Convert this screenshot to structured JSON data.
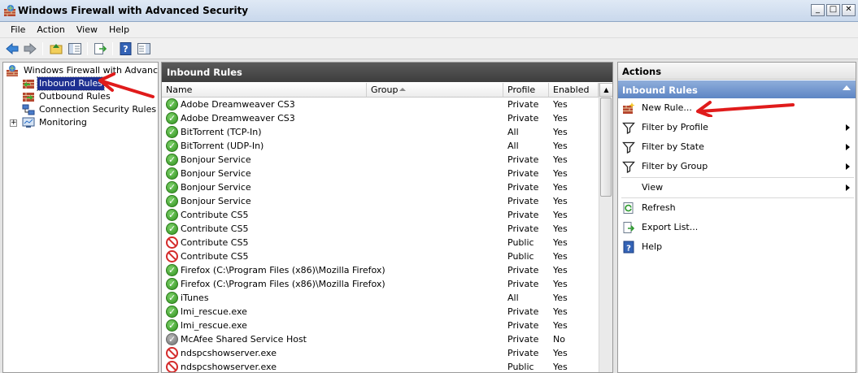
{
  "window": {
    "title": "Windows Firewall with Advanced Security"
  },
  "menu": [
    "File",
    "Action",
    "View",
    "Help"
  ],
  "tree": {
    "root": "Windows Firewall with Advanced S",
    "items": [
      "Inbound Rules",
      "Outbound Rules",
      "Connection Security Rules",
      "Monitoring"
    ],
    "expander": "+"
  },
  "center": {
    "title": "Inbound Rules",
    "columns": [
      "Name",
      "Group",
      "Profile",
      "Enabled"
    ],
    "rows": [
      {
        "status": "allow",
        "name": "Adobe Dreamweaver CS3",
        "group": "",
        "profile": "Private",
        "enabled": "Yes"
      },
      {
        "status": "allow",
        "name": "Adobe Dreamweaver CS3",
        "group": "",
        "profile": "Private",
        "enabled": "Yes"
      },
      {
        "status": "allow",
        "name": "BitTorrent (TCP-In)",
        "group": "",
        "profile": "All",
        "enabled": "Yes"
      },
      {
        "status": "allow",
        "name": "BitTorrent (UDP-In)",
        "group": "",
        "profile": "All",
        "enabled": "Yes"
      },
      {
        "status": "allow",
        "name": "Bonjour Service",
        "group": "",
        "profile": "Private",
        "enabled": "Yes"
      },
      {
        "status": "allow",
        "name": "Bonjour Service",
        "group": "",
        "profile": "Private",
        "enabled": "Yes"
      },
      {
        "status": "allow",
        "name": "Bonjour Service",
        "group": "",
        "profile": "Private",
        "enabled": "Yes"
      },
      {
        "status": "allow",
        "name": "Bonjour Service",
        "group": "",
        "profile": "Private",
        "enabled": "Yes"
      },
      {
        "status": "allow",
        "name": "Contribute CS5",
        "group": "",
        "profile": "Private",
        "enabled": "Yes"
      },
      {
        "status": "allow",
        "name": "Contribute CS5",
        "group": "",
        "profile": "Private",
        "enabled": "Yes"
      },
      {
        "status": "block",
        "name": "Contribute CS5",
        "group": "",
        "profile": "Public",
        "enabled": "Yes"
      },
      {
        "status": "block",
        "name": "Contribute CS5",
        "group": "",
        "profile": "Public",
        "enabled": "Yes"
      },
      {
        "status": "allow",
        "name": "Firefox (C:\\Program Files (x86)\\Mozilla Firefox)",
        "group": "",
        "profile": "Private",
        "enabled": "Yes"
      },
      {
        "status": "allow",
        "name": "Firefox (C:\\Program Files (x86)\\Mozilla Firefox)",
        "group": "",
        "profile": "Private",
        "enabled": "Yes"
      },
      {
        "status": "allow",
        "name": "iTunes",
        "group": "",
        "profile": "All",
        "enabled": "Yes"
      },
      {
        "status": "allow",
        "name": "lmi_rescue.exe",
        "group": "",
        "profile": "Private",
        "enabled": "Yes"
      },
      {
        "status": "allow",
        "name": "lmi_rescue.exe",
        "group": "",
        "profile": "Private",
        "enabled": "Yes"
      },
      {
        "status": "disabled",
        "name": "McAfee Shared Service Host",
        "group": "",
        "profile": "Private",
        "enabled": "No"
      },
      {
        "status": "block",
        "name": "ndspcshowserver.exe",
        "group": "",
        "profile": "Private",
        "enabled": "Yes"
      },
      {
        "status": "block",
        "name": "ndspcshowserver.exe",
        "group": "",
        "profile": "Public",
        "enabled": "Yes"
      }
    ]
  },
  "actions": {
    "title": "Actions",
    "section": "Inbound Rules",
    "items": [
      {
        "label": "New Rule...",
        "icon": "new-rule-icon",
        "submenu": false
      },
      {
        "label": "Filter by Profile",
        "icon": "filter-icon",
        "submenu": true
      },
      {
        "label": "Filter by State",
        "icon": "filter-icon",
        "submenu": true
      },
      {
        "label": "Filter by Group",
        "icon": "filter-icon",
        "submenu": true
      },
      {
        "label": "View",
        "icon": "",
        "submenu": true
      },
      {
        "label": "Refresh",
        "icon": "refresh-icon",
        "submenu": false
      },
      {
        "label": "Export List...",
        "icon": "export-icon",
        "submenu": false
      },
      {
        "label": "Help",
        "icon": "help-icon",
        "submenu": false
      }
    ]
  },
  "colors": {
    "selection": "#1d2f91",
    "panel_header": "#3d3d3d",
    "actions_section": "#5d85c4",
    "annotation_arrow": "#e01b1b",
    "allow": "#2f8f1d",
    "block": "#d42b2b"
  }
}
